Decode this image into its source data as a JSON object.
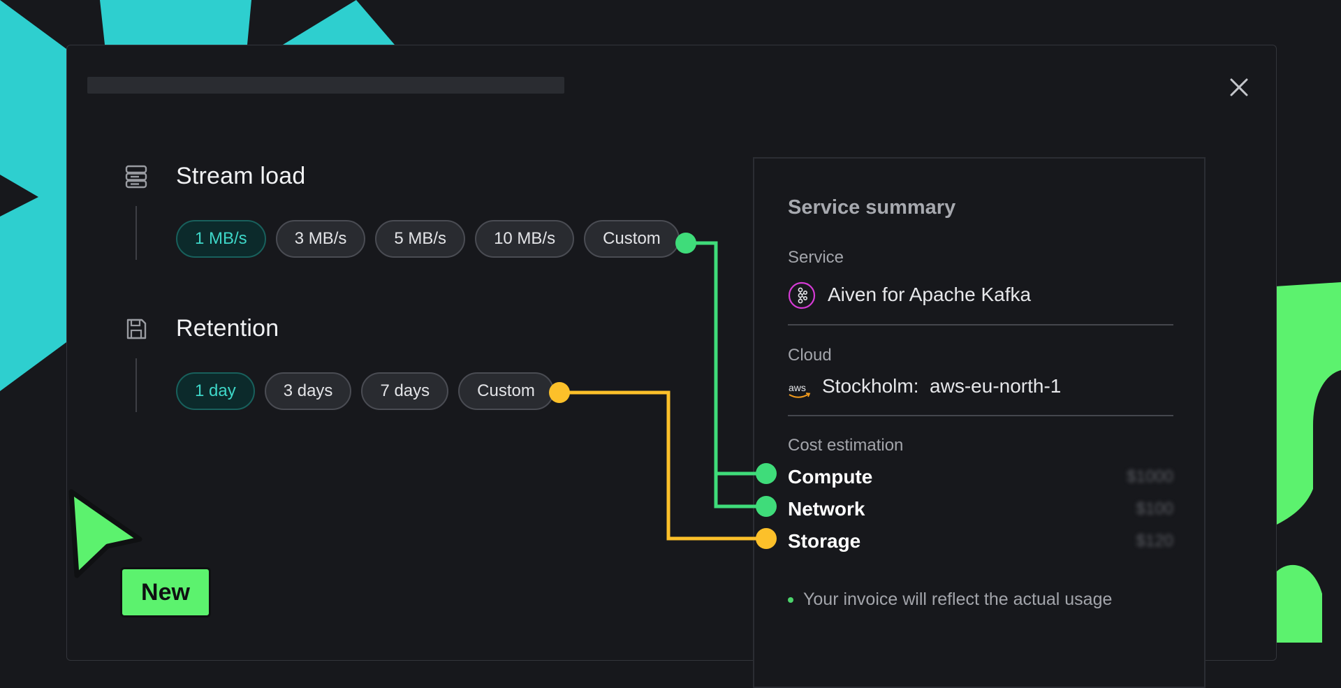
{
  "colors": {
    "accent_teal": "#2ecfcf",
    "accent_green": "#5cf26e",
    "connector_green": "#3fdc7a",
    "connector_yellow": "#fcc02a",
    "panel_bg": "#17181c"
  },
  "dialog": {
    "title": "",
    "close_icon": "close-icon"
  },
  "stream_load": {
    "icon": "server-stack-icon",
    "title": "Stream load",
    "selected": "1 MB/s",
    "options": [
      "1 MB/s",
      "3 MB/s",
      "5 MB/s",
      "10 MB/s",
      "Custom"
    ]
  },
  "retention": {
    "icon": "save-disk-icon",
    "title": "Retention",
    "selected": "1 day",
    "options": [
      "1 day",
      "3 days",
      "7 days",
      "Custom"
    ]
  },
  "summary": {
    "title": "Service summary",
    "service_label": "Service",
    "service_icon": "kafka-icon",
    "service_value": "Aiven for Apache Kafka",
    "cloud_label": "Cloud",
    "cloud_icon": "aws-logo-icon",
    "cloud_value": "Stockholm:  aws-eu-north-1",
    "cost_label": "Cost estimation",
    "costs": [
      {
        "name": "Compute",
        "price": "$1000"
      },
      {
        "name": "Network",
        "price": "$100"
      },
      {
        "name": "Storage",
        "price": "$120"
      }
    ],
    "note": "Your invoice will reflect the actual usage"
  },
  "badge": {
    "label": "New",
    "cursor_icon": "pointer-cursor-icon"
  }
}
